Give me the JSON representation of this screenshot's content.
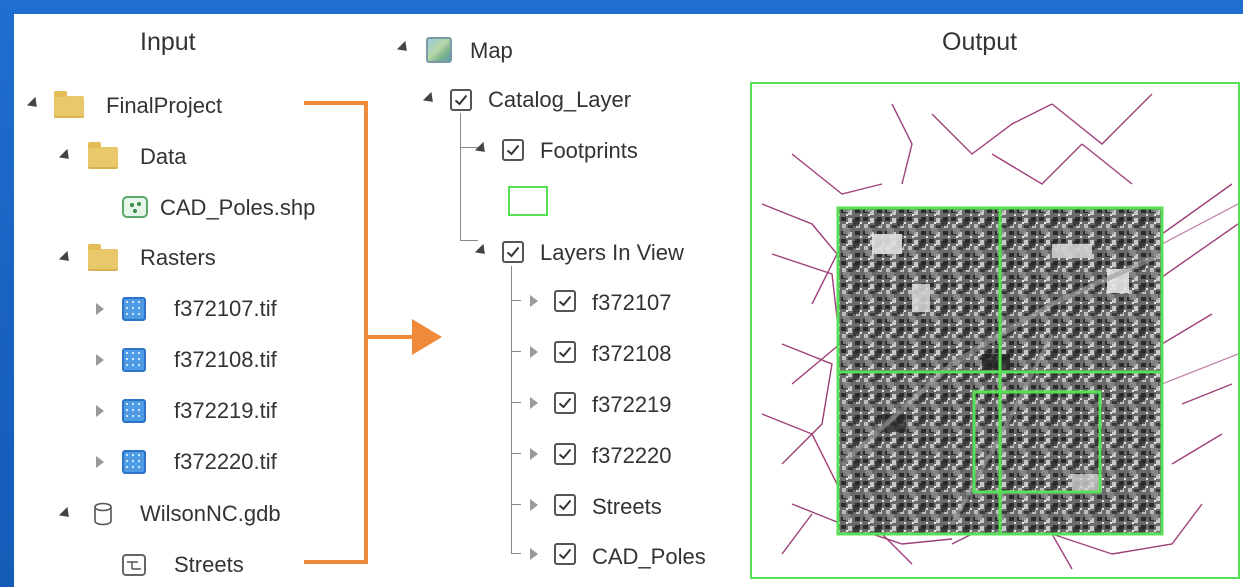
{
  "headings": {
    "input": "Input",
    "output": "Output"
  },
  "input_tree": {
    "root": "FinalProject",
    "data_folder": "Data",
    "cad_poles_shp": "CAD_Poles.shp",
    "rasters_folder": "Rasters",
    "rasters": [
      "f372107.tif",
      "f372108.tif",
      "f372219.tif",
      "f372220.tif"
    ],
    "gdb": "WilsonNC.gdb",
    "streets": "Streets"
  },
  "map_tree": {
    "map": "Map",
    "catalog_layer": "Catalog_Layer",
    "footprints": "Footprints",
    "layers_in_view": "Layers In View",
    "layers": [
      "f372107",
      "f372108",
      "f372219",
      "f372220",
      "Streets",
      "CAD_Poles"
    ]
  },
  "colors": {
    "background_blue": "#1a62c2",
    "arrow_orange": "#ee8a3a",
    "footprint_green": "#55e055",
    "street_lines": "#a0407a",
    "folder_yellow": "#e9c86b",
    "raster_blue": "#4f9be6"
  },
  "icons": {
    "folder": "folder-icon",
    "point_feature": "point-feature-icon",
    "raster": "raster-icon",
    "geodatabase": "database-icon",
    "line_feature": "line-feature-icon",
    "map": "map-icon",
    "checkbox": "checkbox-checked-icon"
  }
}
